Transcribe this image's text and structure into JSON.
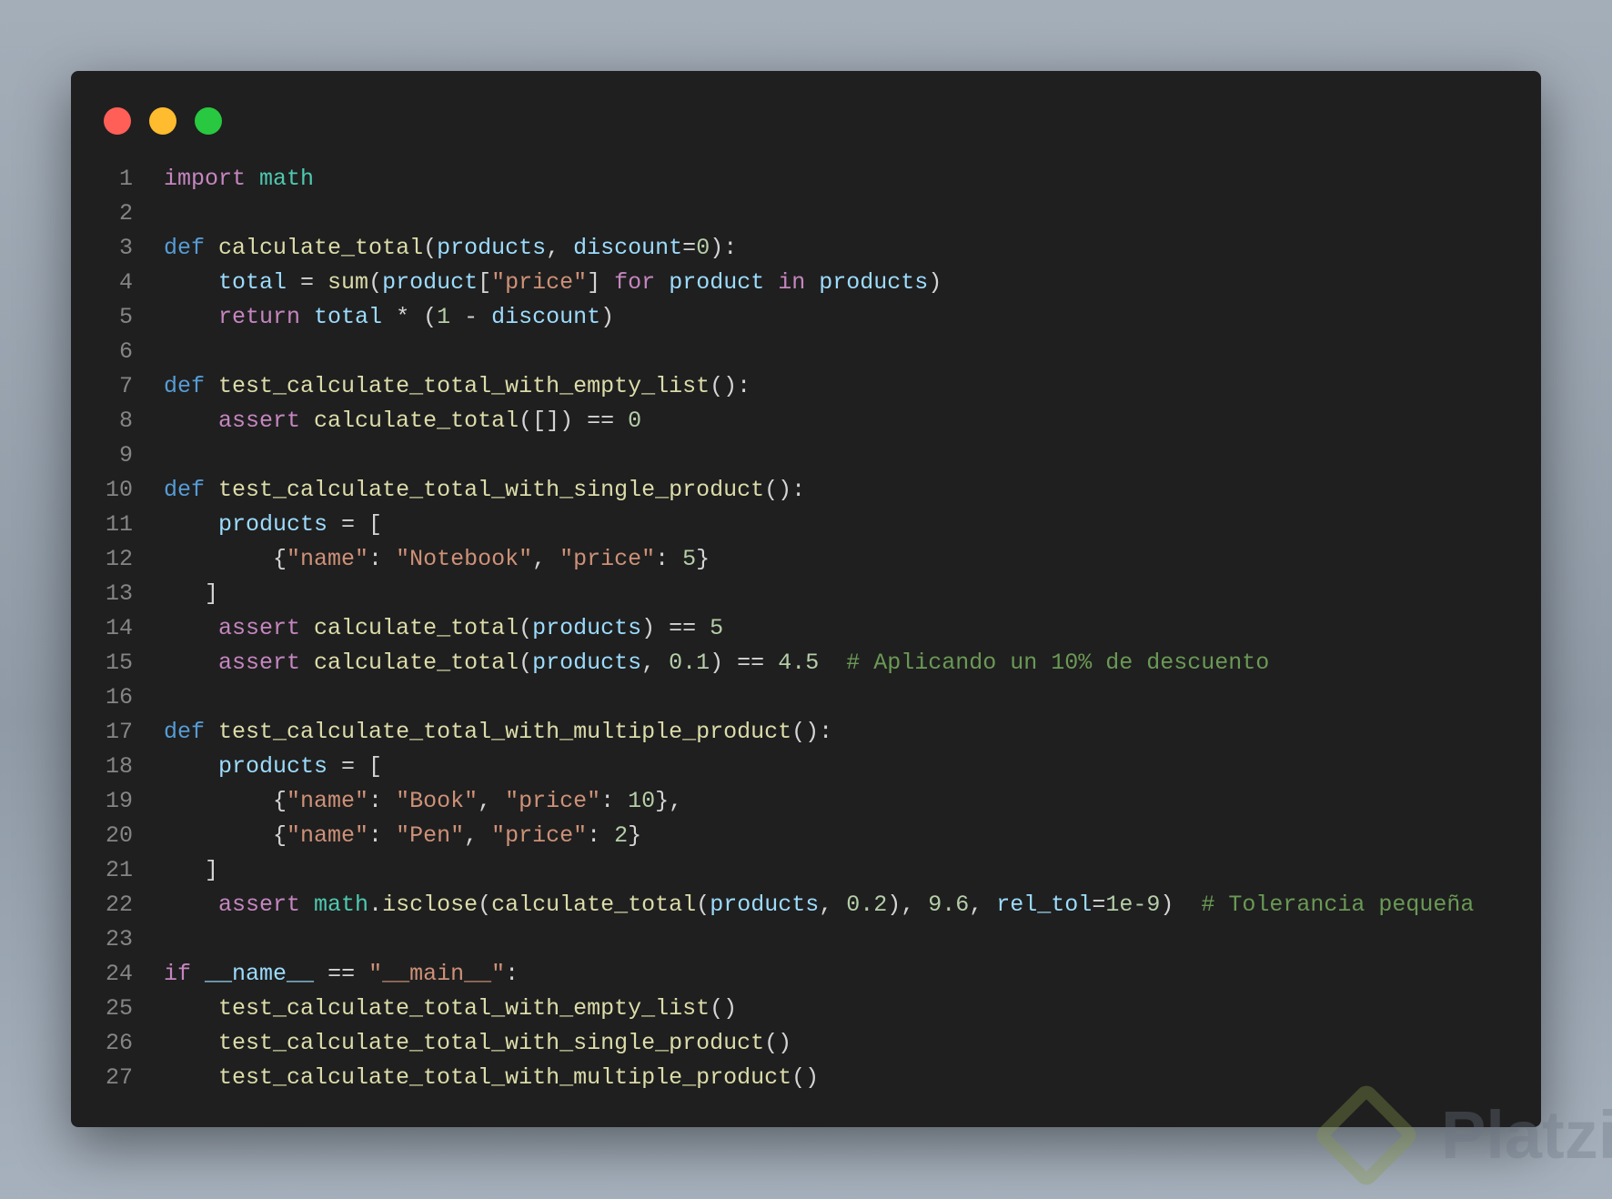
{
  "window_controls": {
    "close": "#ff5f57",
    "minimize": "#febc2e",
    "maximize": "#28c840"
  },
  "watermark": {
    "text": "Platzi"
  },
  "code": {
    "lines": [
      [
        [
          "kw",
          "import"
        ],
        [
          "pl",
          " "
        ],
        [
          "mod",
          "math"
        ]
      ],
      [],
      [
        [
          "def",
          "def"
        ],
        [
          "pl",
          " "
        ],
        [
          "fn",
          "calculate_total"
        ],
        [
          "pl",
          "("
        ],
        [
          "var",
          "products"
        ],
        [
          "pl",
          ", "
        ],
        [
          "var",
          "discount"
        ],
        [
          "pl",
          "="
        ],
        [
          "num",
          "0"
        ],
        [
          "pl",
          "):"
        ]
      ],
      [
        [
          "pl",
          "    "
        ],
        [
          "var",
          "total"
        ],
        [
          "pl",
          " = "
        ],
        [
          "fn",
          "sum"
        ],
        [
          "pl",
          "("
        ],
        [
          "var",
          "product"
        ],
        [
          "pl",
          "["
        ],
        [
          "str",
          "\"price\""
        ],
        [
          "pl",
          "] "
        ],
        [
          "kw",
          "for"
        ],
        [
          "pl",
          " "
        ],
        [
          "var",
          "product"
        ],
        [
          "pl",
          " "
        ],
        [
          "kw",
          "in"
        ],
        [
          "pl",
          " "
        ],
        [
          "var",
          "products"
        ],
        [
          "pl",
          ")"
        ]
      ],
      [
        [
          "pl",
          "    "
        ],
        [
          "kw",
          "return"
        ],
        [
          "pl",
          " "
        ],
        [
          "var",
          "total"
        ],
        [
          "pl",
          " * ("
        ],
        [
          "num",
          "1"
        ],
        [
          "pl",
          " - "
        ],
        [
          "var",
          "discount"
        ],
        [
          "pl",
          ")"
        ]
      ],
      [],
      [
        [
          "def",
          "def"
        ],
        [
          "pl",
          " "
        ],
        [
          "fn",
          "test_calculate_total_with_empty_list"
        ],
        [
          "pl",
          "():"
        ]
      ],
      [
        [
          "pl",
          "    "
        ],
        [
          "kw",
          "assert"
        ],
        [
          "pl",
          " "
        ],
        [
          "fn",
          "calculate_total"
        ],
        [
          "pl",
          "([]) == "
        ],
        [
          "num",
          "0"
        ]
      ],
      [],
      [
        [
          "def",
          "def"
        ],
        [
          "pl",
          " "
        ],
        [
          "fn",
          "test_calculate_total_with_single_product"
        ],
        [
          "pl",
          "():"
        ]
      ],
      [
        [
          "pl",
          "    "
        ],
        [
          "var",
          "products"
        ],
        [
          "pl",
          " = ["
        ]
      ],
      [
        [
          "pl",
          "        {"
        ],
        [
          "str",
          "\"name\""
        ],
        [
          "pl",
          ": "
        ],
        [
          "str",
          "\"Notebook\""
        ],
        [
          "pl",
          ", "
        ],
        [
          "str",
          "\"price\""
        ],
        [
          "pl",
          ": "
        ],
        [
          "num",
          "5"
        ],
        [
          "pl",
          "}"
        ]
      ],
      [
        [
          "pl",
          "   ]"
        ]
      ],
      [
        [
          "pl",
          "    "
        ],
        [
          "kw",
          "assert"
        ],
        [
          "pl",
          " "
        ],
        [
          "fn",
          "calculate_total"
        ],
        [
          "pl",
          "("
        ],
        [
          "var",
          "products"
        ],
        [
          "pl",
          ") == "
        ],
        [
          "num",
          "5"
        ]
      ],
      [
        [
          "pl",
          "    "
        ],
        [
          "kw",
          "assert"
        ],
        [
          "pl",
          " "
        ],
        [
          "fn",
          "calculate_total"
        ],
        [
          "pl",
          "("
        ],
        [
          "var",
          "products"
        ],
        [
          "pl",
          ", "
        ],
        [
          "num",
          "0.1"
        ],
        [
          "pl",
          ") == "
        ],
        [
          "num",
          "4.5"
        ],
        [
          "pl",
          "  "
        ],
        [
          "cm",
          "# Aplicando un 10% de descuento"
        ]
      ],
      [],
      [
        [
          "def",
          "def"
        ],
        [
          "pl",
          " "
        ],
        [
          "fn",
          "test_calculate_total_with_multiple_product"
        ],
        [
          "pl",
          "():"
        ]
      ],
      [
        [
          "pl",
          "    "
        ],
        [
          "var",
          "products"
        ],
        [
          "pl",
          " = ["
        ]
      ],
      [
        [
          "pl",
          "        {"
        ],
        [
          "str",
          "\"name\""
        ],
        [
          "pl",
          ": "
        ],
        [
          "str",
          "\"Book\""
        ],
        [
          "pl",
          ", "
        ],
        [
          "str",
          "\"price\""
        ],
        [
          "pl",
          ": "
        ],
        [
          "num",
          "10"
        ],
        [
          "pl",
          "},"
        ]
      ],
      [
        [
          "pl",
          "        {"
        ],
        [
          "str",
          "\"name\""
        ],
        [
          "pl",
          ": "
        ],
        [
          "str",
          "\"Pen\""
        ],
        [
          "pl",
          ", "
        ],
        [
          "str",
          "\"price\""
        ],
        [
          "pl",
          ": "
        ],
        [
          "num",
          "2"
        ],
        [
          "pl",
          "}"
        ]
      ],
      [
        [
          "pl",
          "   ]"
        ]
      ],
      [
        [
          "pl",
          "    "
        ],
        [
          "kw",
          "assert"
        ],
        [
          "pl",
          " "
        ],
        [
          "mod",
          "math"
        ],
        [
          "pl",
          "."
        ],
        [
          "fn",
          "isclose"
        ],
        [
          "pl",
          "("
        ],
        [
          "fn",
          "calculate_total"
        ],
        [
          "pl",
          "("
        ],
        [
          "var",
          "products"
        ],
        [
          "pl",
          ", "
        ],
        [
          "num",
          "0.2"
        ],
        [
          "pl",
          "), "
        ],
        [
          "num",
          "9.6"
        ],
        [
          "pl",
          ", "
        ],
        [
          "var",
          "rel_tol"
        ],
        [
          "pl",
          "="
        ],
        [
          "num",
          "1e-9"
        ],
        [
          "pl",
          ")  "
        ],
        [
          "cm",
          "# Tolerancia pequeña"
        ]
      ],
      [],
      [
        [
          "kw",
          "if"
        ],
        [
          "pl",
          " "
        ],
        [
          "var",
          "__name__"
        ],
        [
          "pl",
          " == "
        ],
        [
          "str",
          "\"__main__\""
        ],
        [
          "pl",
          ":"
        ]
      ],
      [
        [
          "pl",
          "    "
        ],
        [
          "fn",
          "test_calculate_total_with_empty_list"
        ],
        [
          "pl",
          "()"
        ]
      ],
      [
        [
          "pl",
          "    "
        ],
        [
          "fn",
          "test_calculate_total_with_single_product"
        ],
        [
          "pl",
          "()"
        ]
      ],
      [
        [
          "pl",
          "    "
        ],
        [
          "fn",
          "test_calculate_total_with_multiple_product"
        ],
        [
          "pl",
          "()"
        ]
      ]
    ]
  }
}
